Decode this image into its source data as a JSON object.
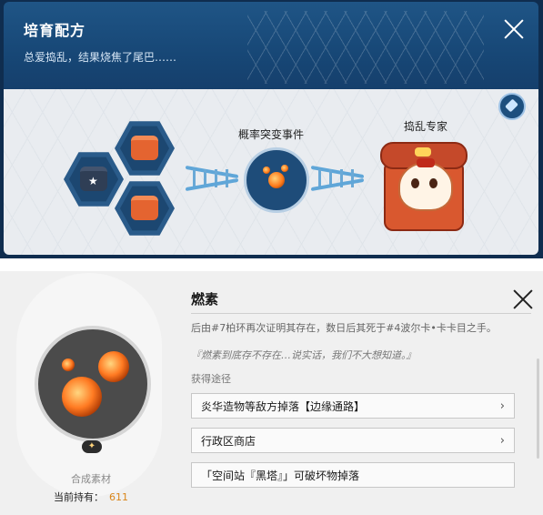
{
  "recipe": {
    "title": "培育配方",
    "subtitle": "总爱捣乱，结果烧焦了尾巴……",
    "center_label": "概率突变事件",
    "result_label": "捣乱专家"
  },
  "item": {
    "title": "燃素",
    "description": "后由#7柏环再次证明其存在，数日后其死于#4波尔卡•卡卡目之手。",
    "quote": "『燃素到底存不存在…说实话，我们不大想知道。』",
    "acquire_label": "获得途径",
    "sources": [
      {
        "label": "炎华造物等敌方掉落【边缘通路】"
      },
      {
        "label": "行政区商店"
      },
      {
        "label": "「空间站『黑塔』」可破坏物掉落"
      }
    ],
    "material_label": "合成素材",
    "hold_label": "当前持有：",
    "hold_count": "611",
    "badge": "✦"
  },
  "colors": {
    "accent": "#1f5586",
    "count": "#d9861a",
    "orb": "#ff7a22"
  }
}
